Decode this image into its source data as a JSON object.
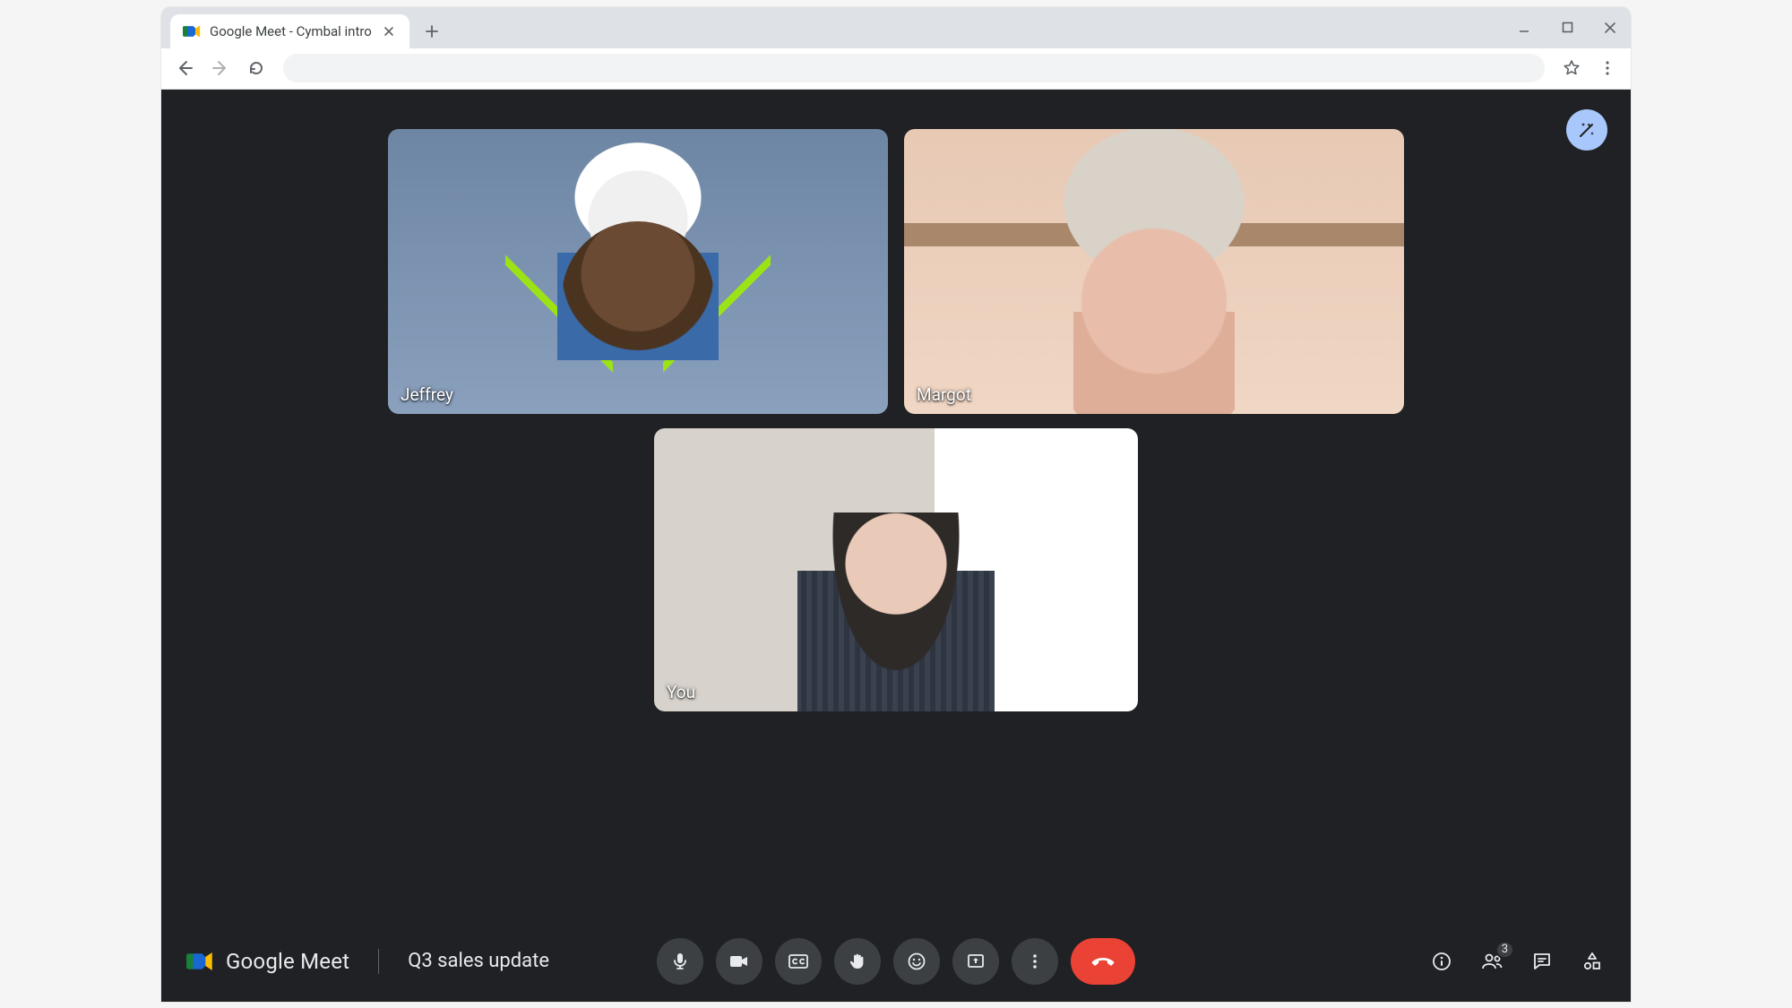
{
  "browser": {
    "tab_title": "Google Meet - Cymbal intro"
  },
  "fx_button": {
    "icon": "magic-wand-icon"
  },
  "participants": [
    {
      "name": "Jeffrey"
    },
    {
      "name": "Margot"
    },
    {
      "name": "You"
    }
  ],
  "footer": {
    "brand": "Google Meet",
    "meeting_title": "Q3 sales update",
    "participant_count": "3"
  },
  "colors": {
    "hangup": "#ea4335",
    "fx_bg": "#a8c7fa",
    "meet_bg": "#202124",
    "ctrl_bg": "#3c4043"
  }
}
